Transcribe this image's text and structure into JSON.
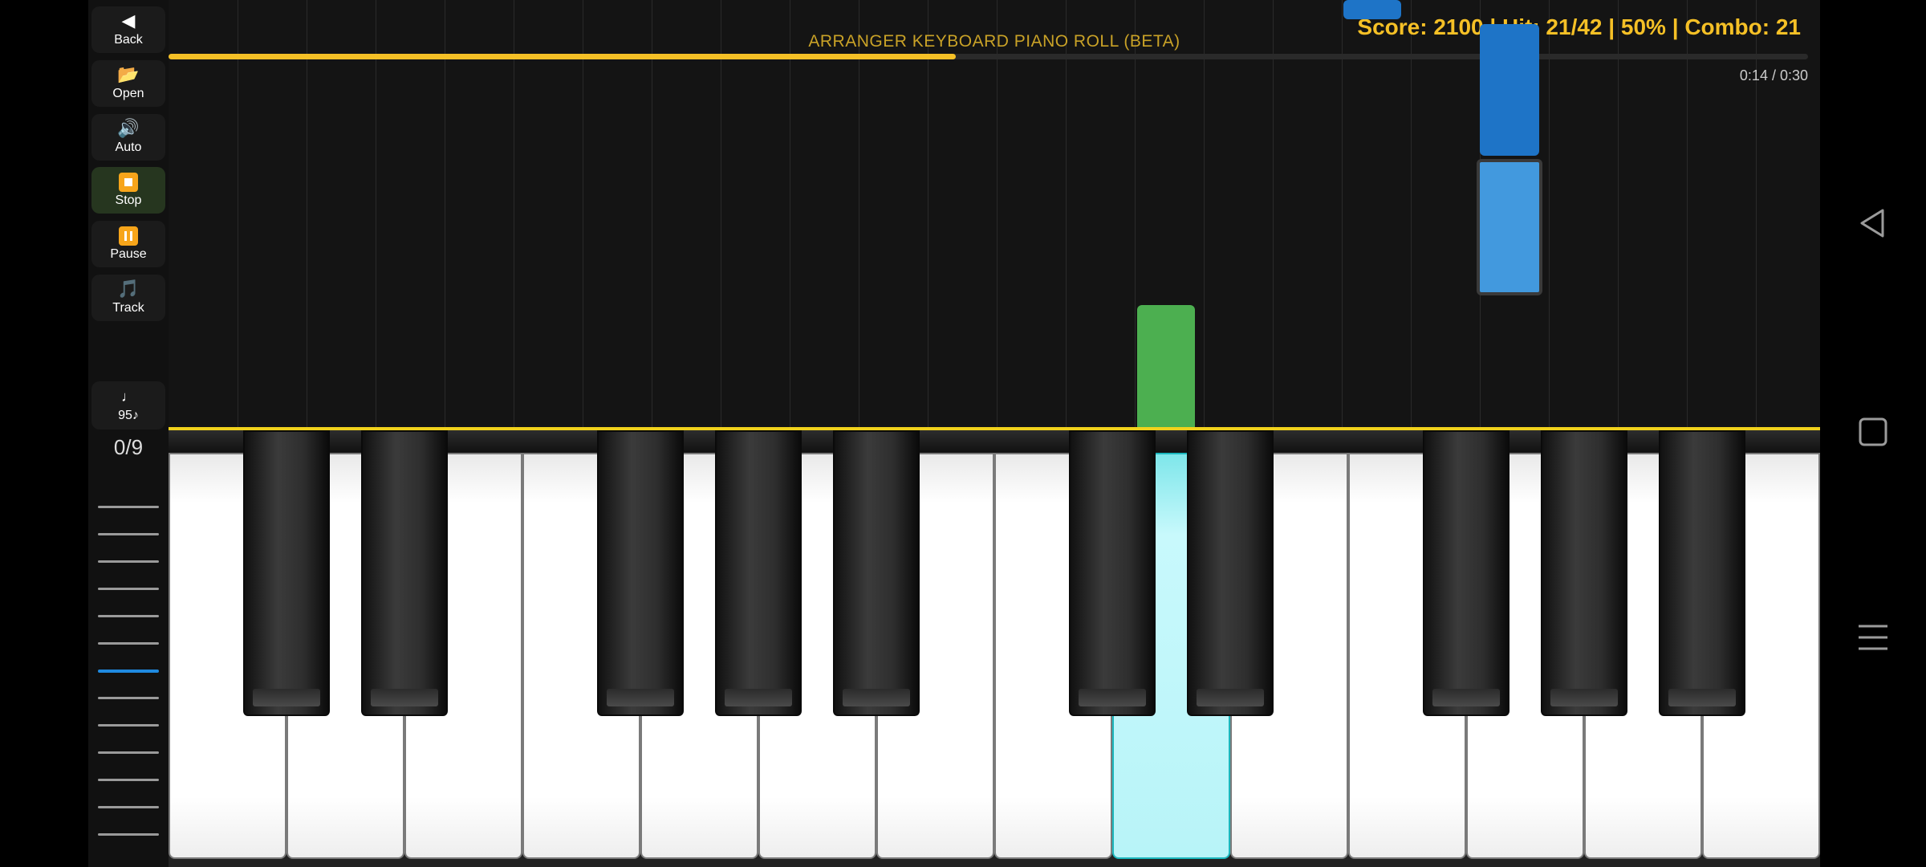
{
  "toolbar": {
    "buttons": [
      {
        "id": "back",
        "icon": "back-arrow-icon",
        "glyph": "◀",
        "label": "Back"
      },
      {
        "id": "open",
        "icon": "folder-icon",
        "glyph": "📂",
        "label": "Open"
      },
      {
        "id": "auto",
        "icon": "speaker-icon",
        "glyph": "🔊",
        "label": "Auto"
      },
      {
        "id": "stop",
        "icon": "stop-icon",
        "glyph": "",
        "label": "Stop"
      },
      {
        "id": "pause",
        "icon": "pause-icon",
        "glyph": "",
        "label": "Pause"
      },
      {
        "id": "track",
        "icon": "music-note-icon",
        "glyph": "🎵",
        "label": "Track"
      }
    ],
    "tempo": {
      "glyph": "♩",
      "label": "95♪"
    },
    "counter": "0/9",
    "slider_levels": 13,
    "slider_selected_index": 6
  },
  "header": {
    "title": "ARRANGER KEYBOARD  PIANO ROLL  (BETA)",
    "score_text": "Score: 2100 | Hit: 21/42 | 50% | Combo: 21",
    "time_text": "0:14 / 0:30",
    "progress": 0.48
  },
  "colors": {
    "accent": "#f5c026",
    "note_green": "#4caf50",
    "note_blue": "#1e74c7",
    "note_blue_light": "#4299de",
    "pressed_key": "#b8f4f8"
  },
  "keyboard": {
    "white_key_count": 14,
    "pressed_white_index": 8
  },
  "nav": {
    "back": "back-triangle-icon",
    "home": "home-square-icon",
    "menu": "menu-lines-icon"
  }
}
